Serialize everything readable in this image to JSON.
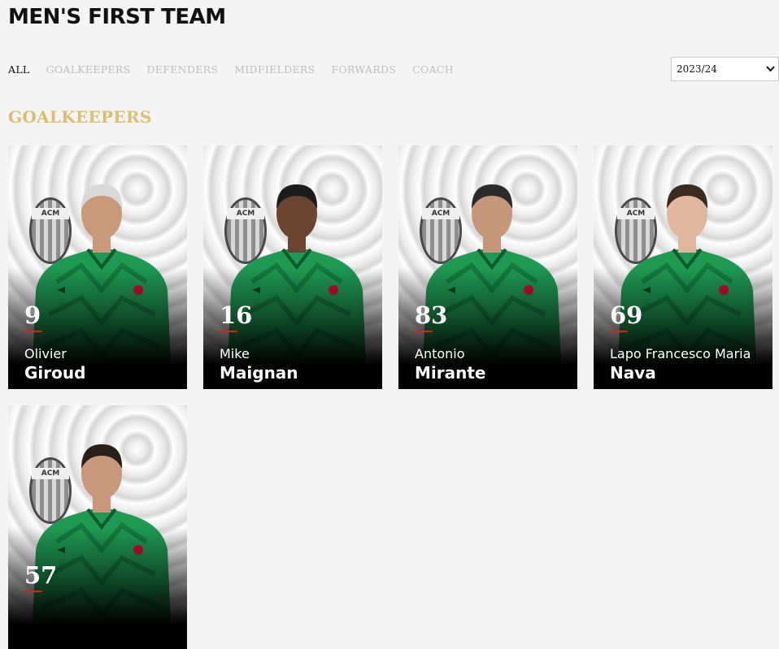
{
  "page": {
    "title": "MEN'S FIRST TEAM"
  },
  "filters": [
    {
      "label": "ALL",
      "active": true
    },
    {
      "label": "GOALKEEPERS",
      "active": false
    },
    {
      "label": "DEFENDERS",
      "active": false
    },
    {
      "label": "MIDFIELDERS",
      "active": false
    },
    {
      "label": "FORWARDS",
      "active": false
    },
    {
      "label": "COACH",
      "active": false
    }
  ],
  "season": {
    "selected": "2023/24"
  },
  "section": {
    "title": "GOALKEEPERS"
  },
  "crest_label": "ACM",
  "colors": {
    "accent_gold": "#dcbd73",
    "number_underline": "#e31b23",
    "kit_green": "#1f9a52"
  },
  "players": [
    {
      "number": "9",
      "first": "Olivier",
      "last": "Giroud",
      "hair": "#d9d9d9",
      "skin": "#c99a7a"
    },
    {
      "number": "16",
      "first": "Mike",
      "last": "Maignan",
      "hair": "#1c1c1c",
      "skin": "#6b4530"
    },
    {
      "number": "83",
      "first": "Antonio",
      "last": "Mirante",
      "hair": "#2b2b2b",
      "skin": "#c4977a"
    },
    {
      "number": "69",
      "first": "Lapo Francesco Maria",
      "last": "Nava",
      "hair": "#3a2a1e",
      "skin": "#e0b79e"
    },
    {
      "number": "57",
      "first": "",
      "last": "",
      "hair": "#2a1f18",
      "skin": "#c9987c"
    }
  ]
}
